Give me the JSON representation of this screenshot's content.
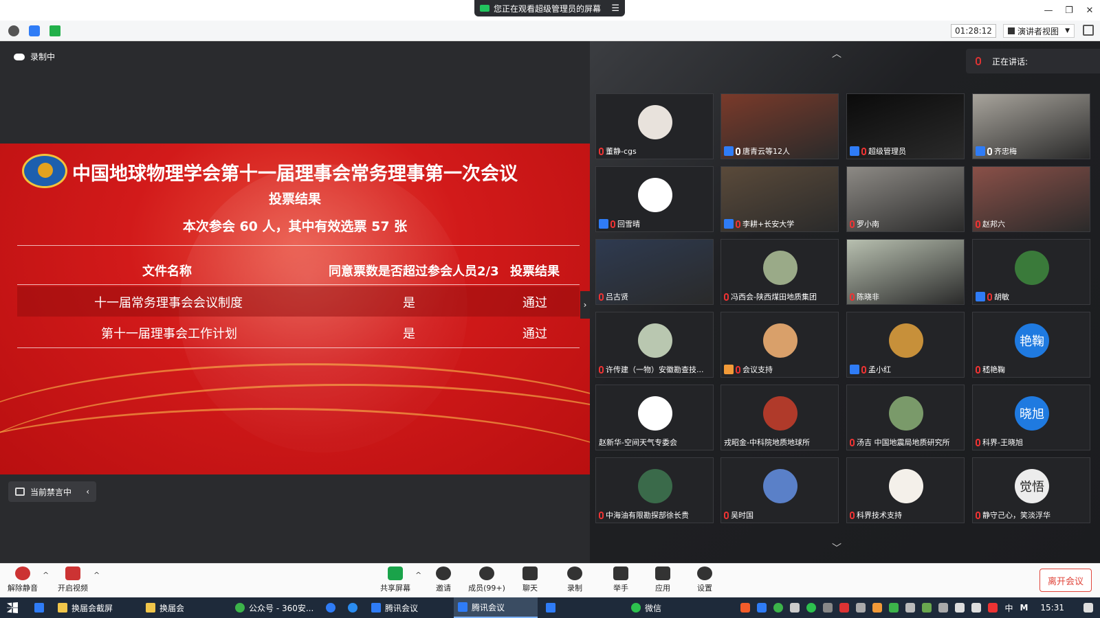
{
  "banner": {
    "text": "您正在观看超级管理员的屏幕"
  },
  "header": {
    "timer": "01:28:12",
    "view_mode": "演讲者视图"
  },
  "recording": {
    "label": "录制中"
  },
  "slide": {
    "title": "中国地球物理学会第十一届理事会常务理事第一次会议",
    "subtitle": "投票结果",
    "stat": "本次参会 60 人，其中有效选票 57 张",
    "columns": [
      "文件名称",
      "同意票数是否超过参会人员2/3",
      "投票结果"
    ],
    "rows": [
      [
        "十一届常务理事会会议制度",
        "是",
        "通过"
      ],
      [
        "第十一届理事会工作计划",
        "是",
        "通过"
      ]
    ]
  },
  "mute_note": "当前禁言中",
  "speaking": {
    "label": "正在讲话:"
  },
  "participants": [
    {
      "name": "董静-cgs",
      "host": false,
      "mic": "off",
      "type": "avatar",
      "color": "#e8e2dc"
    },
    {
      "name": "唐青云等12人",
      "host": true,
      "mic": "on",
      "type": "video",
      "color": "#7a3a2a"
    },
    {
      "name": "超级管理员",
      "host": true,
      "mic": "off",
      "type": "video",
      "color": "#0b0b0b"
    },
    {
      "name": "齐忠梅",
      "host": true,
      "mic": "on",
      "type": "video",
      "color": "#a8a49c"
    },
    {
      "name": "回雪晴",
      "host": true,
      "mic": "off",
      "type": "avatar",
      "color": "#ffffff"
    },
    {
      "name": "李耕+长安大学",
      "host": true,
      "mic": "off",
      "type": "video",
      "color": "#5a4a3a"
    },
    {
      "name": "罗小南",
      "host": false,
      "mic": "off",
      "type": "video",
      "color": "#8d8a85"
    },
    {
      "name": "赵邦六",
      "host": false,
      "mic": "off",
      "type": "video",
      "color": "#8a5048"
    },
    {
      "name": "吕古贤",
      "host": false,
      "mic": "off",
      "type": "video",
      "color": "#2e3a50"
    },
    {
      "name": "冯西会-陕西煤田地质集团",
      "host": false,
      "mic": "off",
      "type": "avatar",
      "color": "#9aaa88"
    },
    {
      "name": "陈晓非",
      "host": false,
      "mic": "off",
      "type": "video",
      "color": "#b8c0b0"
    },
    {
      "name": "胡敏",
      "host": true,
      "mic": "off",
      "type": "avatar",
      "color": "#3a7a3a"
    },
    {
      "name": "许传建（一物）安徽勘查技...",
      "host": false,
      "mic": "off",
      "type": "avatar",
      "color": "#b9c7b0"
    },
    {
      "name": "会议支持",
      "host": true,
      "mic": "off",
      "type": "avatar",
      "color": "#d9a06a",
      "host_color": "#f29a38"
    },
    {
      "name": "孟小红",
      "host": true,
      "mic": "off",
      "type": "avatar",
      "color": "#c7903a"
    },
    {
      "name": "嵇艳鞠",
      "host": false,
      "mic": "off",
      "type": "avatar",
      "color": "#1f7ae0",
      "initials": "艳鞠"
    },
    {
      "name": "赵新华-空间天气专委会",
      "host": false,
      "mic": "none",
      "type": "avatar",
      "color": "#ffffff"
    },
    {
      "name": "戎昭金-中科院地质地球所",
      "host": false,
      "mic": "none",
      "type": "avatar",
      "color": "#b03a2a"
    },
    {
      "name": "汤吉 中国地震局地质研究所",
      "host": false,
      "mic": "off",
      "type": "avatar",
      "color": "#7a9a6a"
    },
    {
      "name": "科界-王晓旭",
      "host": false,
      "mic": "off",
      "type": "avatar",
      "color": "#1f7ae0",
      "initials": "晓旭"
    },
    {
      "name": "中海油有限勘探部徐长贵",
      "host": false,
      "mic": "off",
      "type": "avatar",
      "color": "#3a6a4a"
    },
    {
      "name": "吴时国",
      "host": false,
      "mic": "off",
      "type": "avatar",
      "color": "#5a80c8"
    },
    {
      "name": "科界技术支持",
      "host": false,
      "mic": "off",
      "type": "avatar",
      "color": "#f4f0ea"
    },
    {
      "name": "静守己心，笑淡浮华",
      "host": false,
      "mic": "off",
      "type": "avatar",
      "color": "#ececec",
      "initials": "觉悟"
    }
  ],
  "toolbar": {
    "unmute": "解除静音",
    "video": "开启视频",
    "share": "共享屏幕",
    "invite": "邀请",
    "members": "成员(99+)",
    "chat": "聊天",
    "record": "录制",
    "raise_hand": "举手",
    "apps": "应用",
    "settings": "设置",
    "leave": "离开会议"
  },
  "taskbar": {
    "items": [
      "换届会截屏",
      "换届会",
      "公众号 - 360安...",
      "腾讯会议",
      "腾讯会议",
      "微信"
    ],
    "ime": "中",
    "time": "15:31"
  },
  "colors": {
    "accent": "#1f7ae0",
    "leave": "#e0443a",
    "slide_red": "#d21a1a"
  }
}
